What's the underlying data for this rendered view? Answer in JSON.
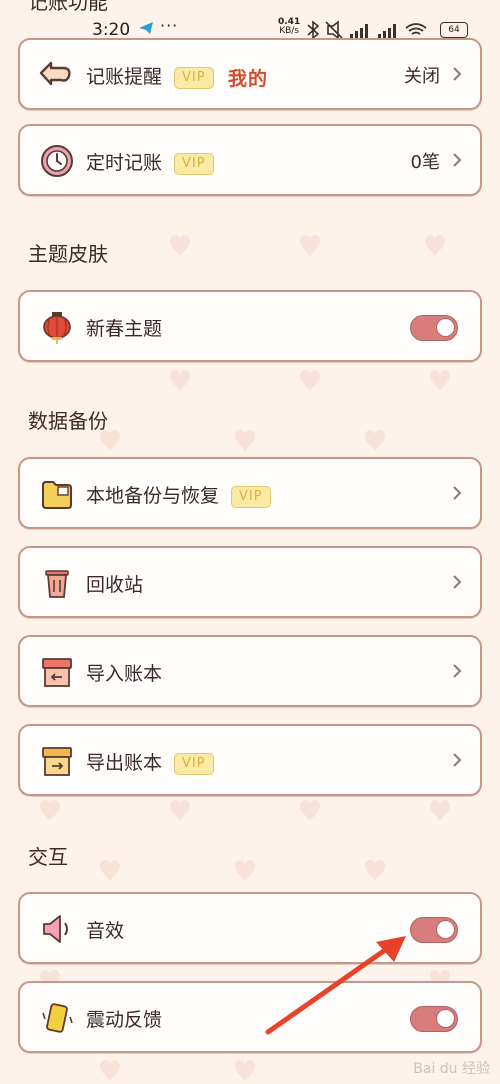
{
  "status_bar": {
    "time": "3:20",
    "dots": "···",
    "speed_value": "0.41",
    "speed_unit": "KB/s",
    "battery": "64"
  },
  "header_cut": "记账功能",
  "overlay_label": "我的",
  "vip_label": "VIP",
  "rows": {
    "reminder": {
      "label": "记账提醒",
      "value": "关闭"
    },
    "scheduled": {
      "label": "定时记账",
      "value": "0笔"
    },
    "theme": {
      "label": "新春主题",
      "on": true
    },
    "local_backup": {
      "label": "本地备份与恢复"
    },
    "recycle": {
      "label": "回收站"
    },
    "import": {
      "label": "导入账本"
    },
    "export": {
      "label": "导出账本"
    },
    "sound": {
      "label": "音效",
      "on": true
    },
    "vibration": {
      "label": "震动反馈",
      "on": true
    }
  },
  "sections": {
    "theme": "主题皮肤",
    "backup": "数据备份",
    "interaction": "交互"
  },
  "watermark": "Bai du 经验",
  "colors": {
    "toggle_on": "#d97c7c",
    "card_border": "#c7968b",
    "annotation_arrow": "#e8432a",
    "vip_bg": "#fbeaa3"
  }
}
